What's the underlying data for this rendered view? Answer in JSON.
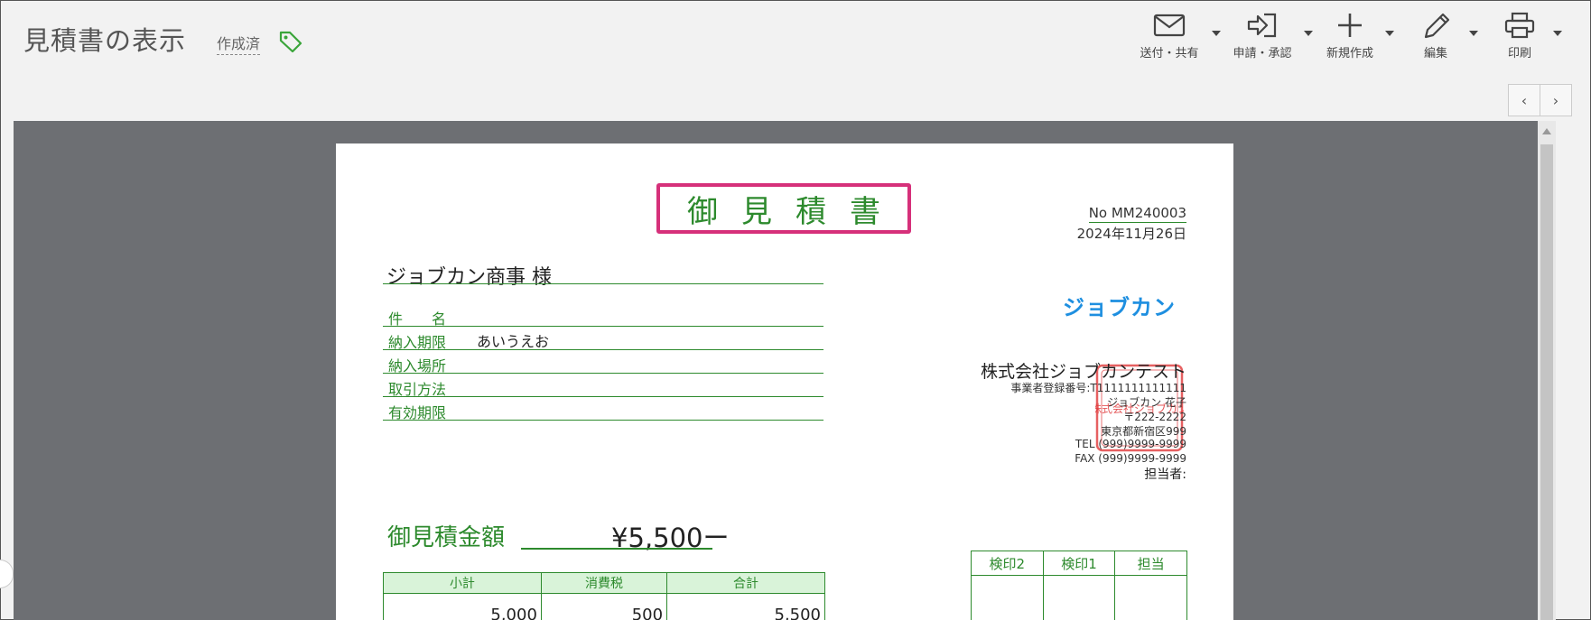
{
  "header": {
    "title": "見積書の表示",
    "status": "作成済"
  },
  "toolbar": [
    {
      "name": "send",
      "label": "送付・共有",
      "icon": "envelope-icon"
    },
    {
      "name": "apply",
      "label": "申請・承認",
      "icon": "sign-in-icon"
    },
    {
      "name": "new",
      "label": "新規作成",
      "icon": "plus-icon"
    },
    {
      "name": "edit",
      "label": "編集",
      "icon": "pencil-icon"
    },
    {
      "name": "print",
      "label": "印刷",
      "icon": "printer-icon"
    }
  ],
  "pager": {
    "prev": "‹",
    "next": "›"
  },
  "document": {
    "title": "御見積書",
    "number": "No MM240003",
    "date": "2024年11月26日",
    "customer": "ジョブカン商事 様",
    "fields": [
      {
        "label": "件　　名",
        "value": ""
      },
      {
        "label": "納入期限",
        "value": "あいうえお"
      },
      {
        "label": "納入場所",
        "value": ""
      },
      {
        "label": "取引方法",
        "value": ""
      },
      {
        "label": "有効期限",
        "value": ""
      }
    ],
    "logo": "ジョブカン",
    "company": "株式会社ジョブカンテスト",
    "reg_no": "事業者登録番号:T1111111111111",
    "person": "ジョブカン 花子",
    "postal": "〒222-2222",
    "address": "東京都新宿区999",
    "tel": "TEL (999)9999-9999",
    "fax": "FAX (999)9999-9999",
    "tanto": "担当者:",
    "seal_text": "株式会社ジョブカン",
    "amount_label": "御見積金額",
    "amount": "¥5,500ー",
    "totals": {
      "headers": [
        "小計",
        "消費税",
        "合計"
      ],
      "values": [
        "5,000",
        "500",
        "5,500"
      ]
    },
    "stamps": [
      "検印2",
      "検印1",
      "担当"
    ]
  },
  "colors": {
    "accent": "#2d8a2d",
    "highlight": "#d6307a",
    "logo": "#1e8fe0",
    "seal": "#e0383a"
  }
}
